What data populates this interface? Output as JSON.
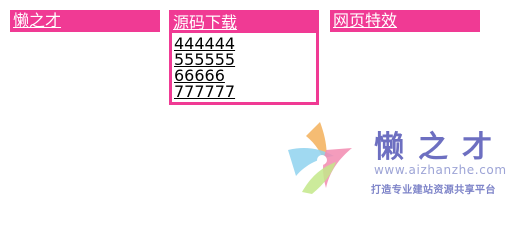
{
  "menus": [
    {
      "title": "懒之才"
    },
    {
      "title": "源码下载",
      "items": [
        "444444",
        "555555",
        "66666",
        "777777"
      ]
    },
    {
      "title": "网页特效"
    }
  ],
  "watermark": {
    "brand": "懒之才",
    "url": "www.aizhanzhe.com",
    "slogan": "打造专业建站资源共享平台"
  },
  "colors": {
    "menu_bg": "#f03a94",
    "menu_text": "#ffffff",
    "link_text": "#000000",
    "watermark": "#6d6fc1"
  }
}
